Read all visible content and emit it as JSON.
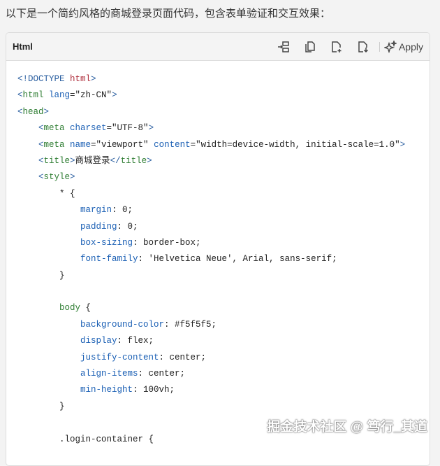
{
  "intro": "以下是一个简约风格的商城登录页面代码，包含表单验证和交互效果：",
  "code_block": {
    "language": "Html",
    "toolbar": [
      {
        "icon": "insert-icon"
      },
      {
        "icon": "copy-icon"
      },
      {
        "icon": "new-file-icon"
      },
      {
        "icon": "download-file-icon"
      }
    ],
    "apply_label": "Apply",
    "lines": [
      [
        [
          "<!DOCTYPE ",
          "p"
        ],
        [
          "html",
          "k"
        ],
        [
          ">",
          "p"
        ]
      ],
      [
        [
          "<",
          "p"
        ],
        [
          "html ",
          "t"
        ],
        [
          "lang",
          "a"
        ],
        [
          "=\"zh-CN\"",
          "s"
        ],
        [
          ">",
          "p"
        ]
      ],
      [
        [
          "<",
          "p"
        ],
        [
          "head",
          "t"
        ],
        [
          ">",
          "p"
        ]
      ],
      [
        [
          "    <",
          "p"
        ],
        [
          "meta ",
          "t"
        ],
        [
          "charset",
          "a"
        ],
        [
          "=\"UTF-8\"",
          "s"
        ],
        [
          ">",
          "p"
        ]
      ],
      [
        [
          "    <",
          "p"
        ],
        [
          "meta ",
          "t"
        ],
        [
          "name",
          "a"
        ],
        [
          "=\"viewport\" ",
          "s"
        ],
        [
          "content",
          "a"
        ],
        [
          "=\"width=device-width, initial-scale=1.0\"",
          "s"
        ],
        [
          ">",
          "p"
        ]
      ],
      [
        [
          "    <",
          "p"
        ],
        [
          "title",
          "t"
        ],
        [
          ">",
          "p"
        ],
        [
          "商城登录",
          "v"
        ],
        [
          "</",
          "p"
        ],
        [
          "title",
          "t"
        ],
        [
          ">",
          "p"
        ]
      ],
      [
        [
          "    <",
          "p"
        ],
        [
          "style",
          "t"
        ],
        [
          ">",
          "p"
        ]
      ],
      [
        [
          "        * {",
          "v"
        ]
      ],
      [
        [
          "            ",
          "v"
        ],
        [
          "margin",
          "prop"
        ],
        [
          ": 0;",
          "v"
        ]
      ],
      [
        [
          "            ",
          "v"
        ],
        [
          "padding",
          "prop"
        ],
        [
          ": 0;",
          "v"
        ]
      ],
      [
        [
          "            ",
          "v"
        ],
        [
          "box-sizing",
          "prop"
        ],
        [
          ": border-box;",
          "v"
        ]
      ],
      [
        [
          "            ",
          "v"
        ],
        [
          "font-family",
          "prop"
        ],
        [
          ": 'Helvetica Neue', Arial, sans-serif;",
          "v"
        ]
      ],
      [
        [
          "        }",
          "v"
        ]
      ],
      [
        [
          "",
          "v"
        ]
      ],
      [
        [
          "        ",
          "v"
        ],
        [
          "body",
          "sel"
        ],
        [
          " {",
          "v"
        ]
      ],
      [
        [
          "            ",
          "v"
        ],
        [
          "background-color",
          "prop"
        ],
        [
          ": #f5f5f5;",
          "v"
        ]
      ],
      [
        [
          "            ",
          "v"
        ],
        [
          "display",
          "prop"
        ],
        [
          ": flex;",
          "v"
        ]
      ],
      [
        [
          "            ",
          "v"
        ],
        [
          "justify-content",
          "prop"
        ],
        [
          ": center;",
          "v"
        ]
      ],
      [
        [
          "            ",
          "v"
        ],
        [
          "align-items",
          "prop"
        ],
        [
          ": center;",
          "v"
        ]
      ],
      [
        [
          "            ",
          "v"
        ],
        [
          "min-height",
          "prop"
        ],
        [
          ": 100vh;",
          "v"
        ]
      ],
      [
        [
          "        }",
          "v"
        ]
      ],
      [
        [
          "",
          "v"
        ]
      ],
      [
        [
          "        .login-container {",
          "v"
        ]
      ]
    ]
  },
  "watermark": "掘金技术社区 @ 笃行_其道"
}
